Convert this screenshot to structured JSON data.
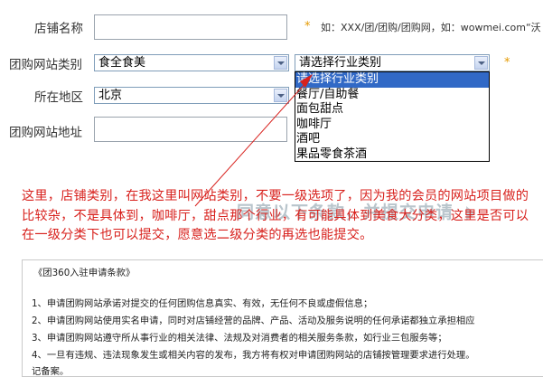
{
  "form": {
    "shop_name": {
      "label": "店铺名称",
      "value": "",
      "hint_prefix": "*",
      "hint": "如：XXX/团/团购/团购网，如：wowmei.com“沃"
    },
    "category": {
      "label": "团购网站类别",
      "first_level": {
        "selected": "食全食美"
      },
      "second_level": {
        "selected": "请选择行业类别"
      },
      "required_mark": "*"
    },
    "region": {
      "label": "所在地区",
      "selected": "北京"
    },
    "site_url": {
      "label": "团购网站地址",
      "value": ""
    }
  },
  "dropdown": {
    "options": [
      {
        "label": "请选择行业类别",
        "selected": true
      },
      {
        "label": "餐厅/自助餐",
        "selected": false
      },
      {
        "label": "面包甜点",
        "selected": false
      },
      {
        "label": "咖啡厅",
        "selected": false
      },
      {
        "label": "酒吧",
        "selected": false
      },
      {
        "label": "果品零食茶酒",
        "selected": false
      }
    ]
  },
  "annotation": {
    "text": "这里，店铺类别，在我这里叫网站类别，不要一级选项了，因为我的会员的网站项目做的比较杂，不是具体到，咖啡厅，甜点那个行业，有可能具体到美食大分类，这里是否可以在一级分类下也可以提交，愿意选二级分类的再选也能提交。"
  },
  "agree_banner": {
    "text": "同意以下条款，并提交申请"
  },
  "terms": {
    "title": "《团360入驻申请条款》",
    "lines": [
      "1、申请团购网站承诺对提交的任何团购信息真实、有效，无任何不良或虚假信息；",
      "2、申请团购网站使用实名申请，同时对店铺经营的品牌、产品、活动及服务说明的任何承诺都独立承担相应",
      "3、申请团购网站遵守所从事行业的相关法律、法规及对消费者的相关服务条款，如行业三包服务等；",
      "4、一旦有违规、违法现象发生或相关内容的发布，我方将有权对申请团购网站的店铺按管理要求进行处理。",
      "记备案。"
    ]
  },
  "colors": {
    "annotation": "#d8221e",
    "selected_option_bg": "#3169c6",
    "banner_text": "#b9c5cc",
    "required_star": "#e59a00"
  }
}
